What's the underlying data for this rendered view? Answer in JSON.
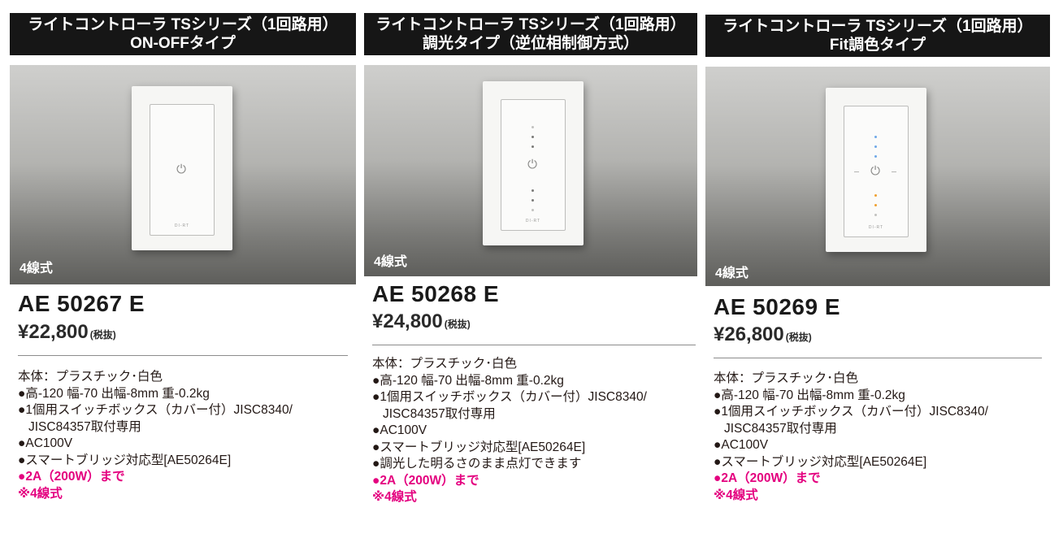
{
  "products": [
    {
      "header_line1": "ライトコントローラ TSシリーズ（1回路用）",
      "header_line2": "ON-OFFタイプ",
      "wire_label": "4線式",
      "model": "AE 50267 E",
      "price": "¥22,800",
      "tax_note": "(税抜)",
      "specs": {
        "body": "本体：プラスチック･白色",
        "size": "●高-120 幅-70 出幅-8mm 重-0.2kg",
        "box_line1": "●1個用スイッチボックス（カバー付）JISC8340/",
        "box_line2": "JISC84357取付専用",
        "voltage": "●AC100V",
        "bridge": "●スマートブリッジ対応型[AE50264E]",
        "rating": "●2A（200W）まで",
        "wire_note": "※4線式"
      }
    },
    {
      "header_line1": "ライトコントローラ TSシリーズ（1回路用）",
      "header_line2": "調光タイプ（逆位相制御方式）",
      "wire_label": "4線式",
      "model": "AE 50268 E",
      "price": "¥24,800",
      "tax_note": "(税抜)",
      "specs": {
        "body": "本体：プラスチック･白色",
        "size": "●高-120 幅-70 出幅-8mm 重-0.2kg",
        "box_line1": "●1個用スイッチボックス（カバー付）JISC8340/",
        "box_line2": "JISC84357取付専用",
        "voltage": "●AC100V",
        "bridge": "●スマートブリッジ対応型[AE50264E]",
        "extra": "●調光した明るさのまま点灯できます",
        "rating": "●2A（200W）まで",
        "wire_note": "※4線式"
      }
    },
    {
      "header_line1": "ライトコントローラ TSシリーズ（1回路用）",
      "header_line2": "Fit調色タイプ",
      "wire_label": "4線式",
      "model": "AE 50269 E",
      "price": "¥26,800",
      "tax_note": "(税抜)",
      "specs": {
        "body": "本体：プラスチック･白色",
        "size": "●高-120 幅-70 出幅-8mm 重-0.2kg",
        "box_line1": "●1個用スイッチボックス（カバー付）JISC8340/",
        "box_line2": "JISC84357取付専用",
        "voltage": "●AC100V",
        "bridge": "●スマートブリッジ対応型[AE50264E]",
        "rating": "●2A（200W）まで",
        "wire_note": "※4線式"
      }
    }
  ],
  "switch_marking": "DI-RT",
  "colors": {
    "header_bg": "#161616",
    "accent_pink": "#e4007f",
    "text": "#231815"
  },
  "icons": {
    "power": "power-icon"
  }
}
